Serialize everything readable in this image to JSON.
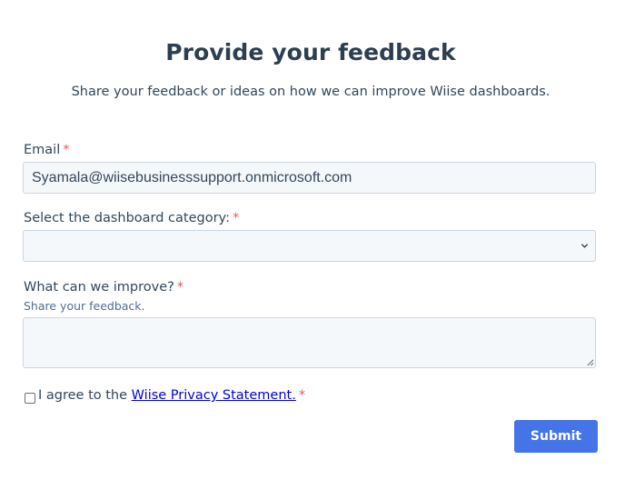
{
  "form": {
    "title": "Provide your feedback",
    "subtitle": "Share your feedback or ideas on how we can improve Wiise dashboards.",
    "required_marker": "*",
    "email": {
      "label": "Email",
      "value": "Syamala@wiisebusinesssupport.onmicrosoft.com"
    },
    "category": {
      "label": "Select the dashboard category:",
      "selected": ""
    },
    "improve": {
      "label": "What can we improve?",
      "hint": "Share your feedback.",
      "value": ""
    },
    "consent": {
      "checked": false,
      "text": "I agree to the",
      "link_text": "Wiise Privacy Statement."
    },
    "submit_label": "Submit"
  },
  "colors": {
    "heading": "#2d3e50",
    "text": "#33475b",
    "required": "#f2545b",
    "field_bg": "#f5f8fa",
    "field_border": "#cbd6e2",
    "button": "#4574e8",
    "link": "#0000ee"
  },
  "icons": {
    "select": "chevron-down-icon",
    "textarea": "resize-handle-icon"
  }
}
